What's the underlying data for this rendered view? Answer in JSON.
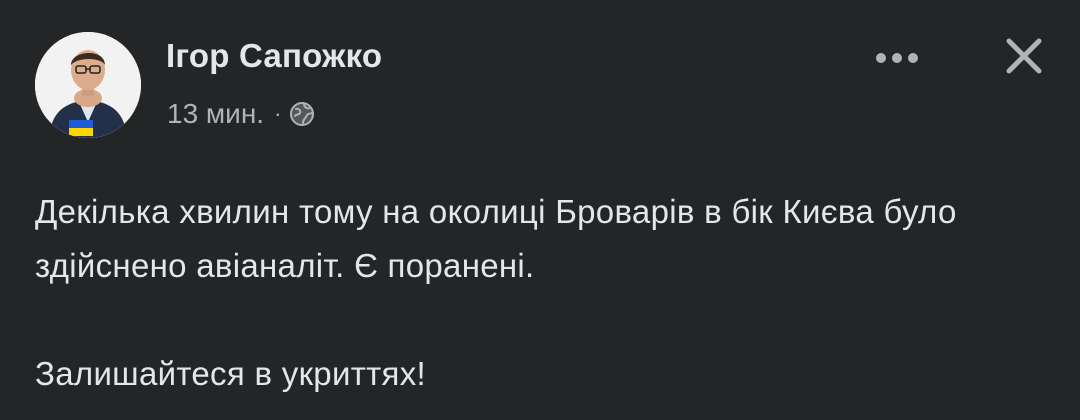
{
  "post": {
    "author_name": "Ігор Сапожко",
    "time": "13 мин.",
    "separator": "·",
    "audience_icon": "globe-icon",
    "more_icon": "more-options-icon",
    "close_icon": "close-icon",
    "paragraphs": [
      "Декілька хвилин тому на околиці Броварів в бік Києва було здійснено авіаналіт. Є поранені.",
      "Залишайтеся в укриттях!"
    ]
  },
  "colors": {
    "background": "#242526",
    "primary_text": "#e4e6eb",
    "secondary_text": "#b0b3b8",
    "flag_blue": "#1e5bd8",
    "flag_yellow": "#ffd500"
  }
}
